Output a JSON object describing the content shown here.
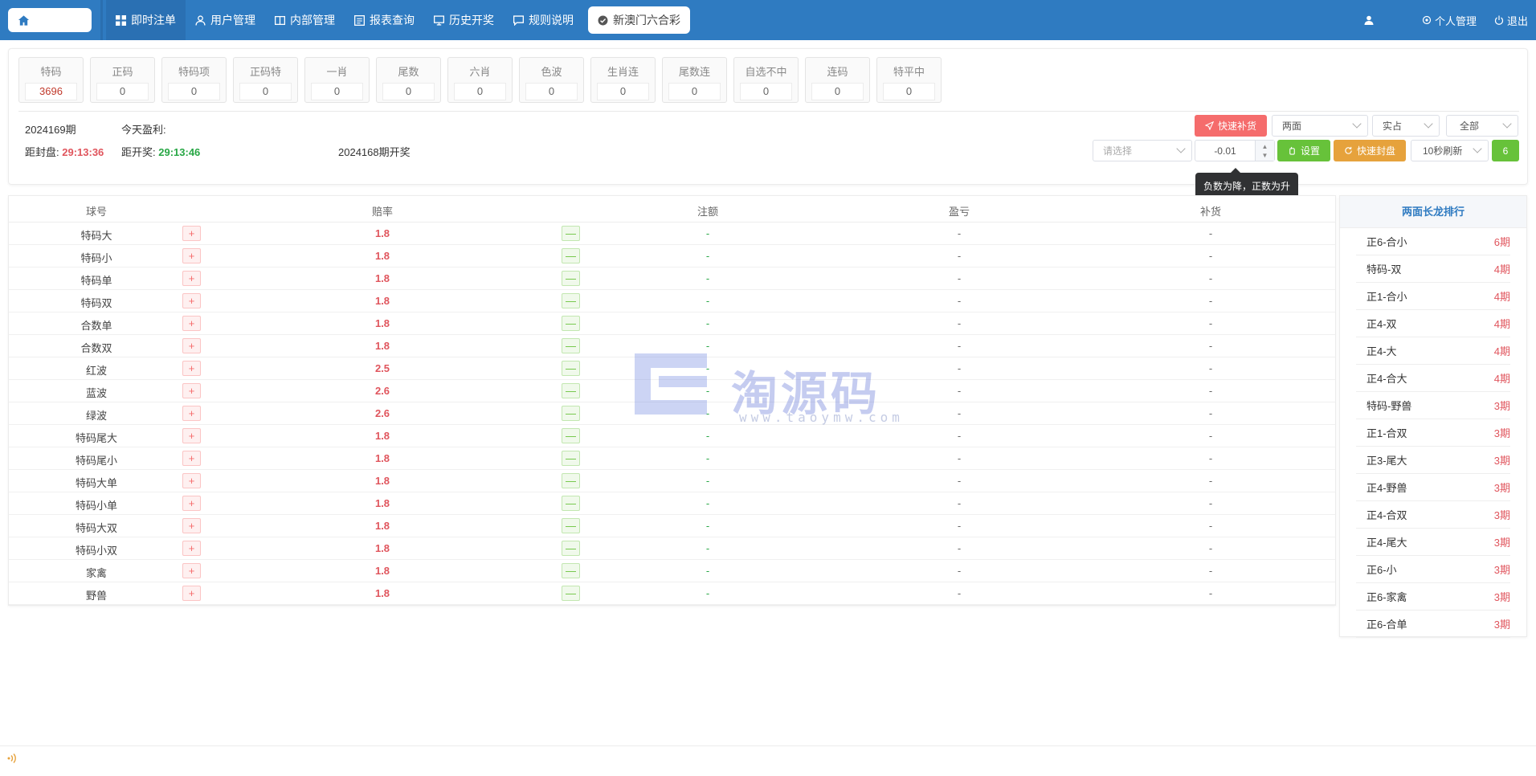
{
  "nav": {
    "items": [
      {
        "label": "即时注单",
        "icon": "grid-icon"
      },
      {
        "label": "用户管理",
        "icon": "user-icon"
      },
      {
        "label": "内部管理",
        "icon": "book-icon"
      },
      {
        "label": "报表查询",
        "icon": "report-icon"
      },
      {
        "label": "历史开奖",
        "icon": "monitor-icon"
      },
      {
        "label": "规则说明",
        "icon": "message-icon"
      }
    ],
    "current_tab": "新澳门六合彩",
    "personal": "个人管理",
    "logout": "退出"
  },
  "tiles": [
    {
      "label": "特码",
      "value": "3696"
    },
    {
      "label": "正码",
      "value": "0"
    },
    {
      "label": "特码项",
      "value": "0"
    },
    {
      "label": "正码特",
      "value": "0"
    },
    {
      "label": "一肖",
      "value": "0"
    },
    {
      "label": "尾数",
      "value": "0"
    },
    {
      "label": "六肖",
      "value": "0"
    },
    {
      "label": "色波",
      "value": "0"
    },
    {
      "label": "生肖连",
      "value": "0"
    },
    {
      "label": "尾数连",
      "value": "0"
    },
    {
      "label": "自选不中",
      "value": "0"
    },
    {
      "label": "连码",
      "value": "0"
    },
    {
      "label": "特平中",
      "value": "0"
    }
  ],
  "info": {
    "period": "2024169期",
    "profit_label": "今天盈利:",
    "close_label": "距封盘:",
    "close_time": "29:13:36",
    "draw_label": "距开奖:",
    "draw_time": "29:13:46",
    "last_draw": "2024168期开奖"
  },
  "controls": {
    "quick_restock": "快速补货",
    "select_type": "两面",
    "select_mode": "实占",
    "select_scope": "全部",
    "select_placeholder": "请选择",
    "stepper_value": "-0.01",
    "set_button": "设置",
    "quick_close": "快速封盘",
    "refresh": "10秒刷新",
    "refresh_count": "6",
    "tooltip": "负数为降，正数为升"
  },
  "table": {
    "headers": {
      "ball": "球号",
      "odds": "赔率",
      "bet": "注额",
      "pnl": "盈亏",
      "restock": "补货"
    },
    "rows": [
      {
        "name": "特码大",
        "odds": "1.8",
        "bet": "-",
        "pnl": "-",
        "restock": "-"
      },
      {
        "name": "特码小",
        "odds": "1.8",
        "bet": "-",
        "pnl": "-",
        "restock": "-"
      },
      {
        "name": "特码单",
        "odds": "1.8",
        "bet": "-",
        "pnl": "-",
        "restock": "-"
      },
      {
        "name": "特码双",
        "odds": "1.8",
        "bet": "-",
        "pnl": "-",
        "restock": "-"
      },
      {
        "name": "合数单",
        "odds": "1.8",
        "bet": "-",
        "pnl": "-",
        "restock": "-"
      },
      {
        "name": "合数双",
        "odds": "1.8",
        "bet": "-",
        "pnl": "-",
        "restock": "-"
      },
      {
        "name": "红波",
        "odds": "2.5",
        "bet": "-",
        "pnl": "-",
        "restock": "-"
      },
      {
        "name": "蓝波",
        "odds": "2.6",
        "bet": "-",
        "pnl": "-",
        "restock": "-"
      },
      {
        "name": "绿波",
        "odds": "2.6",
        "bet": "-",
        "pnl": "-",
        "restock": "-"
      },
      {
        "name": "特码尾大",
        "odds": "1.8",
        "bet": "-",
        "pnl": "-",
        "restock": "-"
      },
      {
        "name": "特码尾小",
        "odds": "1.8",
        "bet": "-",
        "pnl": "-",
        "restock": "-"
      },
      {
        "name": "特码大单",
        "odds": "1.8",
        "bet": "-",
        "pnl": "-",
        "restock": "-"
      },
      {
        "name": "特码小单",
        "odds": "1.8",
        "bet": "-",
        "pnl": "-",
        "restock": "-"
      },
      {
        "name": "特码大双",
        "odds": "1.8",
        "bet": "-",
        "pnl": "-",
        "restock": "-"
      },
      {
        "name": "特码小双",
        "odds": "1.8",
        "bet": "-",
        "pnl": "-",
        "restock": "-"
      },
      {
        "name": "家禽",
        "odds": "1.8",
        "bet": "-",
        "pnl": "-",
        "restock": "-"
      },
      {
        "name": "野兽",
        "odds": "1.8",
        "bet": "-",
        "pnl": "-",
        "restock": "-"
      }
    ],
    "plus": "+",
    "minus": "—"
  },
  "ranking": {
    "title": "两面长龙排行",
    "items": [
      {
        "name": "正6-合小",
        "periods": "6期"
      },
      {
        "name": "特码-双",
        "periods": "4期"
      },
      {
        "name": "正1-合小",
        "periods": "4期"
      },
      {
        "name": "正4-双",
        "periods": "4期"
      },
      {
        "name": "正4-大",
        "periods": "4期"
      },
      {
        "name": "正4-合大",
        "periods": "4期"
      },
      {
        "name": "特码-野兽",
        "periods": "3期"
      },
      {
        "name": "正1-合双",
        "periods": "3期"
      },
      {
        "name": "正3-尾大",
        "periods": "3期"
      },
      {
        "name": "正4-野兽",
        "periods": "3期"
      },
      {
        "name": "正4-合双",
        "periods": "3期"
      },
      {
        "name": "正4-尾大",
        "periods": "3期"
      },
      {
        "name": "正6-小",
        "periods": "3期"
      },
      {
        "name": "正6-家禽",
        "periods": "3期"
      },
      {
        "name": "正6-合单",
        "periods": "3期"
      }
    ]
  },
  "watermark": {
    "brand": "淘源码",
    "url": "www.taoymw.com"
  },
  "colors": {
    "nav": "#2f7bc1",
    "red": "#e0555d",
    "green": "#28a745",
    "orange": "#e6a23c"
  }
}
